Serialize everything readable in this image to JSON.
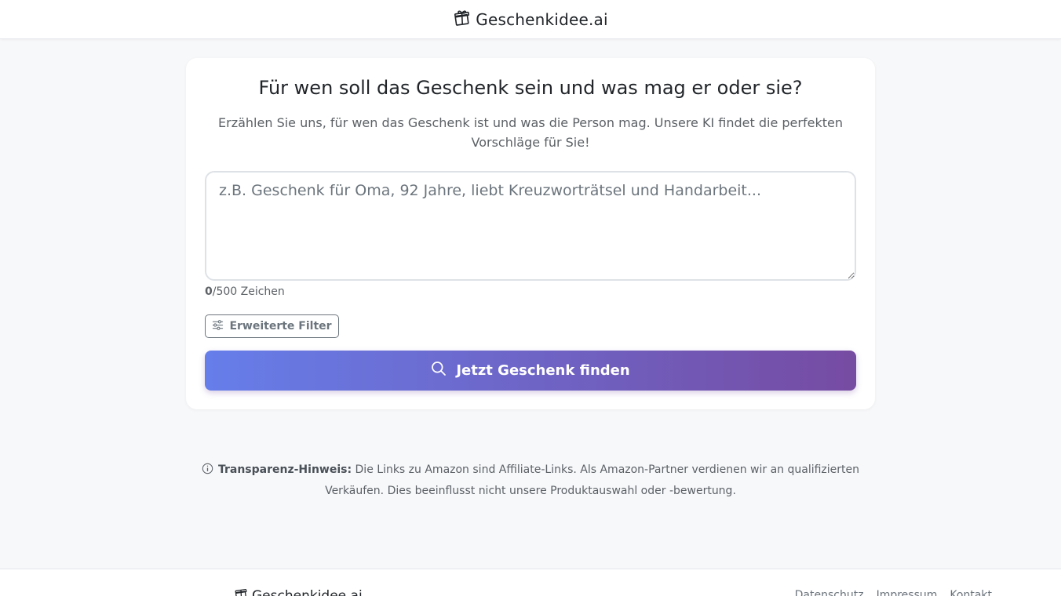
{
  "header": {
    "brand_name": "Geschenkidee.ai",
    "brand_icon": "gift-box-icon"
  },
  "form": {
    "headline": "Für wen soll das Geschenk sein und was mag er oder sie?",
    "subline": "Erzählen Sie uns, für wen das Geschenk ist und was die Person mag. Unsere KI findet die perfekten Vorschläge für Sie!",
    "textarea_value": "",
    "textarea_placeholder": "z.B. Geschenk für Oma, 92 Jahre, liebt Kreuzworträtsel und Handarbeit...",
    "char_count": "0",
    "char_limit_label": "/500 Zeichen",
    "filter_button_label": "Erweiterte Filter",
    "submit_button_label": "Jetzt Geschenk finden"
  },
  "notice": {
    "title": "Transparenz-Hinweis:",
    "text": "Die Links zu Amazon sind Affiliate-Links. Als Amazon-Partner verdienen wir an qualifizierten Verkäufen. Dies beeinflusst nicht unsere Produktauswahl oder -bewertung."
  },
  "footer": {
    "brand_name": "Geschenkidee.ai",
    "links": [
      "Datenschutz",
      "Impressum",
      "Kontakt"
    ]
  },
  "colors": {
    "gradient_start": "#667eea",
    "gradient_end": "#764ba2",
    "page_background": "#f7f8fa"
  }
}
